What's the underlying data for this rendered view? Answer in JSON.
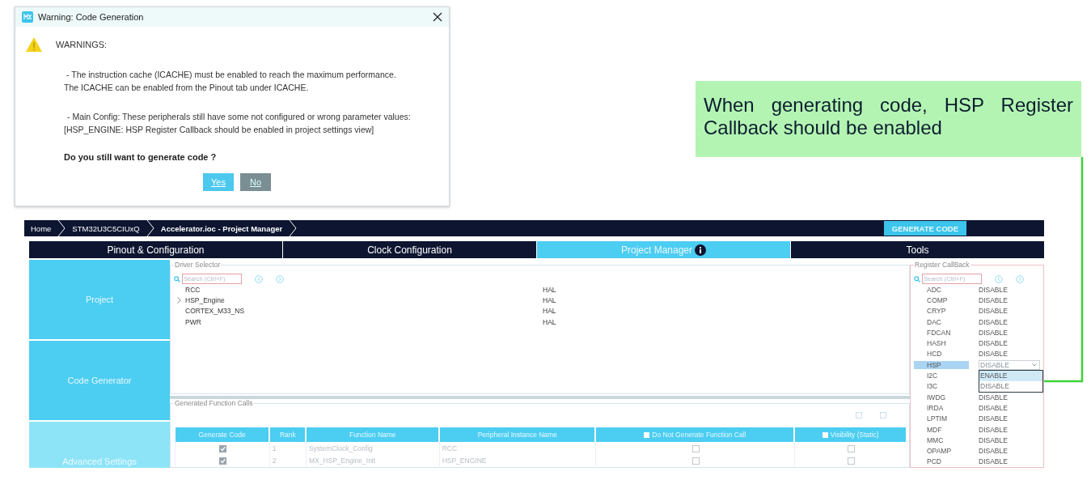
{
  "dialog": {
    "title": "Warning: Code Generation",
    "heading": "WARNINGS:",
    "messages": [
      [
        "- The instruction cache (ICACHE) must be enabled to reach the maximum performance.",
        "The ICACHE can be enabled from the Pinout tab under ICACHE."
      ],
      [
        "- Main Config: These peripherals still have some not configured or wrong parameter values:",
        "[HSP_ENGINE: HSP Register Callback should be enabled in project settings view]"
      ]
    ],
    "question": "Do you still want to generate code ?",
    "buttons": [
      {
        "label": "Yes",
        "selected": true
      },
      {
        "label": "No",
        "selected": false
      }
    ]
  },
  "callout": {
    "text": "When generating code, HSP Register Callback should be enabled"
  },
  "app": {
    "breadcrumb": [
      "Home",
      "STM32U3C5CIUxQ",
      "Accelerator.ioc - Project Manager"
    ],
    "generate_button": "GENERATE CODE",
    "tabs": [
      {
        "label": "Pinout & Configuration",
        "selected": false,
        "info": false
      },
      {
        "label": "Clock Configuration",
        "selected": false,
        "info": false
      },
      {
        "label": "Project Manager",
        "selected": true,
        "info": true
      },
      {
        "label": "Tools",
        "selected": false,
        "info": false
      }
    ],
    "sidebar": [
      {
        "label": "Project",
        "highlighted": false
      },
      {
        "label": "Code Generator",
        "highlighted": false
      },
      {
        "label": "Advanced Settings",
        "highlighted": true
      }
    ],
    "driver_selector": {
      "title": "Driver Selector",
      "placeholder": "Search (Ctrl+F)",
      "rows": [
        {
          "name": "RCC",
          "value": "HAL",
          "expandable": false
        },
        {
          "name": "HSP_Engine",
          "value": "HAL",
          "expandable": true
        },
        {
          "name": "CORTEX_M33_NS",
          "value": "HAL",
          "expandable": false
        },
        {
          "name": "PWR",
          "value": "HAL",
          "expandable": false
        }
      ]
    },
    "function_calls": {
      "title": "Generated Function Calls",
      "columns": [
        {
          "label": "Generate Code",
          "kind": "plain"
        },
        {
          "label": "Rank",
          "kind": "plain"
        },
        {
          "label": "Function Name",
          "kind": "plain"
        },
        {
          "label": "Peripheral Instance Name",
          "kind": "plain"
        },
        {
          "label": "Do Not Generate Function Call",
          "kind": "checkbox",
          "checked": false
        },
        {
          "label": "Visibility (Static)",
          "kind": "checkbox",
          "checked": false
        }
      ],
      "rows": [
        {
          "generate": true,
          "rank": "1",
          "function": "SystemClock_Config",
          "instance": "RCC",
          "no_generate": false,
          "visibility": false
        },
        {
          "generate": true,
          "rank": "2",
          "function": "MX_HSP_Engine_Init",
          "instance": "HSP_ENGINE",
          "no_generate": false,
          "visibility": false
        }
      ]
    },
    "register_callback": {
      "title": "Register CallBack",
      "placeholder": "Search (Ctrl+F)",
      "rows": [
        {
          "name": "ADC",
          "value": "DISABLE",
          "selected": false
        },
        {
          "name": "COMP",
          "value": "DISABLE",
          "selected": false
        },
        {
          "name": "CRYP",
          "value": "DISABLE",
          "selected": false
        },
        {
          "name": "DAC",
          "value": "DISABLE",
          "selected": false
        },
        {
          "name": "FDCAN",
          "value": "DISABLE",
          "selected": false
        },
        {
          "name": "HASH",
          "value": "DISABLE",
          "selected": false
        },
        {
          "name": "HCD",
          "value": "DISABLE",
          "selected": false
        },
        {
          "name": "HSP",
          "value": "DISABLE",
          "selected": true
        },
        {
          "name": "I2C",
          "selected": false
        },
        {
          "name": "I3C",
          "selected": false
        },
        {
          "name": "IWDG",
          "value": "DISABLE",
          "selected": false
        },
        {
          "name": "IRDA",
          "value": "DISABLE",
          "selected": false
        },
        {
          "name": "LPTIM",
          "value": "DISABLE",
          "selected": false
        },
        {
          "name": "MDF",
          "value": "DISABLE",
          "selected": false
        },
        {
          "name": "MMC",
          "value": "DISABLE",
          "selected": false
        },
        {
          "name": "OPAMP",
          "value": "DISABLE",
          "selected": false
        },
        {
          "name": "PCD",
          "value": "DISABLE",
          "selected": false
        }
      ],
      "dropdown": [
        {
          "label": "ENABLE",
          "highlighted": true
        },
        {
          "label": "DISABLE",
          "highlighted": false
        }
      ]
    }
  }
}
